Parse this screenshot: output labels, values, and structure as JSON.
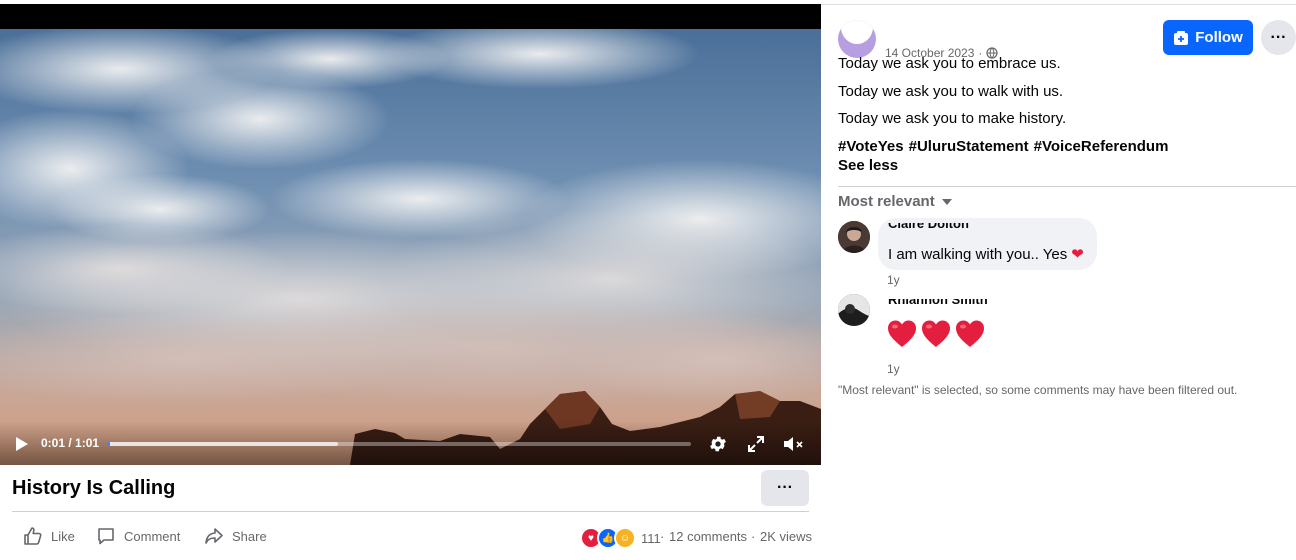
{
  "video": {
    "time_display": "0:01 / 1:01",
    "progress_played_fraction": 0.001,
    "progress_buffered_fraction": 0.395,
    "icons": {
      "play": "play-icon",
      "settings": "gear-icon",
      "fullscreen": "fullscreen-icon",
      "mute": "muted-speaker-icon"
    }
  },
  "video_footer": {
    "title": "History Is Calling",
    "more_label": "···",
    "actions": {
      "like": "Like",
      "comment": "Comment",
      "share": "Share"
    },
    "reaction_count": "111",
    "comments_count": "12 comments",
    "views_count": "2K views",
    "separator": "·"
  },
  "post": {
    "date": "14 October 2023",
    "date_separator": "·",
    "follow_label": "Follow",
    "more_label": "···",
    "lines": [
      "Today we ask you to embrace us.",
      "Today we ask you to walk with us.",
      "Today we ask you to make history."
    ],
    "hashtags": [
      "#VoteYes",
      "#UluruStatement",
      "#VoiceReferendum"
    ],
    "see_less": "See less"
  },
  "comments": {
    "sort_label": "Most relevant",
    "items": [
      {
        "author": "Claire Dolton",
        "text": "I am walking with you.. Yes",
        "emoji": "❤",
        "time": "1y"
      },
      {
        "author": "Rhiannon Smith",
        "emoji_text": "❤❤❤",
        "time": "1y"
      }
    ],
    "filter_note": "\"Most relevant\" is selected, so some comments may have been filtered out."
  },
  "colors": {
    "accent": "#0866ff",
    "muted_text": "#65676b",
    "divider": "#ced0d4",
    "heart_red": "#e41e3f"
  }
}
